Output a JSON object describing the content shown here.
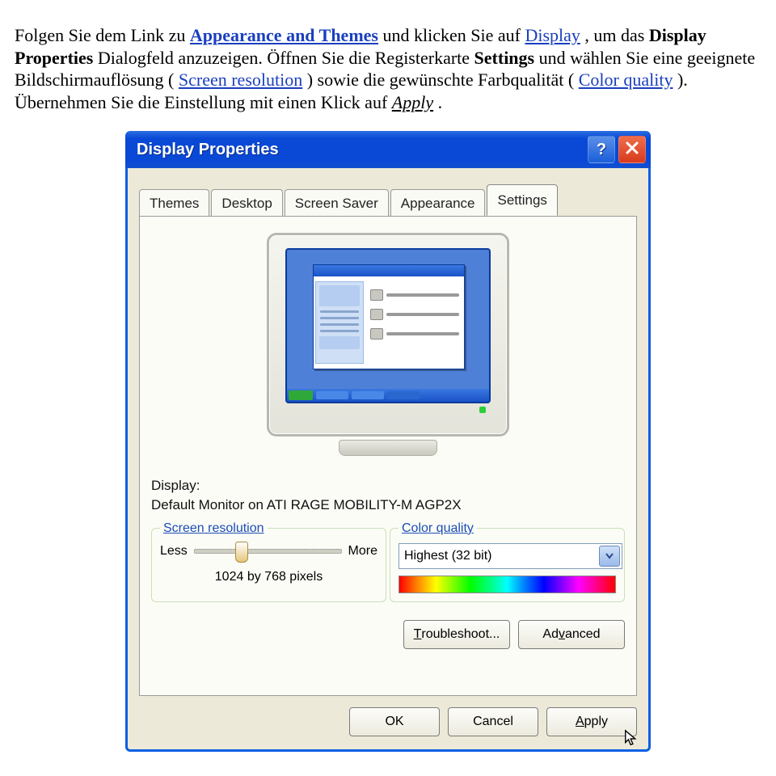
{
  "paragraph": {
    "t1": "Folgen Sie dem Link zu ",
    "link1": "Appearance and Themes",
    "t2": " und klicken Sie auf ",
    "link2": "Display",
    "t3": ", um das ",
    "bold1": "Display Properties",
    "t4": " Dialogfeld anzuzeigen. Öffnen Sie die Registerkarte ",
    "bold2": "Settings",
    "t5": " und wählen Sie eine geeignete Bildschirmauflösung (",
    "link3": "Screen resolution",
    "t6": ") sowie die gewünschte Farbqualität (",
    "link4": "Color quality",
    "t7": "). Übernehmen Sie die Einstellung mit einen Klick auf ",
    "italic1": "Apply",
    "t8": "."
  },
  "dialog": {
    "title": "Display Properties",
    "tabs": [
      "Themes",
      "Desktop",
      "Screen Saver",
      "Appearance",
      "Settings"
    ],
    "active_tab": 4,
    "display_label": "Display:",
    "display_value": "Default Monitor on ATI RAGE MOBILITY-M AGP2X",
    "resolution": {
      "group_title": "Screen resolution",
      "less": "Less",
      "more": "More",
      "readout": "1024 by 768 pixels"
    },
    "color": {
      "group_title": "Color quality",
      "selected": "Highest (32 bit)"
    },
    "troubleshoot_prefix": "T",
    "troubleshoot_rest": "roubleshoot...",
    "advanced_prefix": "Ad",
    "advanced_u": "v",
    "advanced_rest": "anced",
    "ok": "OK",
    "cancel": "Cancel",
    "apply_u": "A",
    "apply_rest": "pply"
  }
}
